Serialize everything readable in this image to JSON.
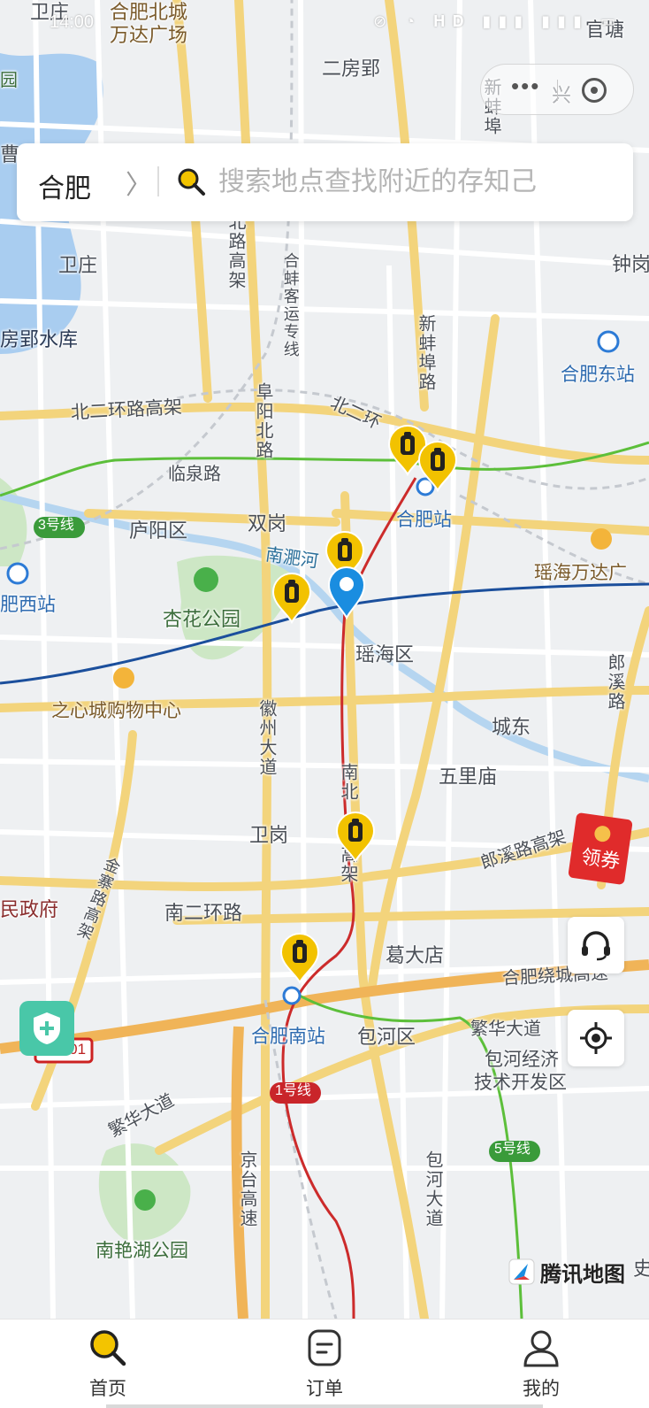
{
  "status_bar": {
    "time": "14:00",
    "system_icons": "⊘ ◔ 𝐇𝐃 ▮▮▮ ▮▮▮ ▭"
  },
  "capsule": {
    "more_icon": "more-dots-icon",
    "close_icon": "close-target-icon"
  },
  "search": {
    "city": "合肥",
    "chevron": "〉",
    "placeholder": "搜索地点查找附近的存知己",
    "value": ""
  },
  "map_labels": {
    "weizhuang_top": "卫庄",
    "wanda_beicheng_1": "合肥北城",
    "wanda_beicheng_2": "万达广场",
    "guantang": "官塘",
    "erfangying": "二房郢",
    "xing": "兴",
    "xinbanglu_top": "新蚌埠",
    "cao": "曹",
    "yuan": "园",
    "beilu_gaojia": "北路高架",
    "hebang_yunzhuan": "合蚌客运专线",
    "weizhuang": "卫庄",
    "zhongan": "钟岗",
    "dafangying": "房郢水库",
    "xinbengbulu": "新蚌埠路",
    "hefei_dongzhan": "合肥东站",
    "bei2huan_gaojia": "北二环路高架",
    "fuyang_beilu": "阜阳北路",
    "bei2huan": "北二环",
    "linquanlu": "临泉路",
    "line3": "3号线",
    "luyang": "庐阳区",
    "shuanggang": "双岗",
    "hefeizhan": "合肥站",
    "yaohai_wanda": "瑶海万达广",
    "nanfeihe": "南淝河",
    "feixi_zhan": "肥西站",
    "xinghua_park": "杏花公园",
    "yaohai": "瑶海区",
    "zhixincheng": "之心城购物中心",
    "langxilu": "郎溪路",
    "huizhou_dadao": "徽州大道",
    "chengdong": "城东",
    "nanbei_gaojia": "南北",
    "jia": "高架",
    "wulimiao": "五里庙",
    "weigang": "卫岗",
    "langxi_gaojia": "郎溪路高架",
    "jinzhai_gaojia": "金寨路高架",
    "minzhengfu": "民政府",
    "nan2huan": "南二环路",
    "gedadian": "葛大店",
    "ring_gaosu": "合肥绕城高速",
    "nanzhan": "合肥南站",
    "baohe": "包河区",
    "fanhua_e": "繁华大道",
    "baohe_jingji_1": "包河经济",
    "baohe_jingji_2": "技术开发区",
    "g4001": "G4001",
    "line1": "1号线",
    "fanhua_w": "繁华大道",
    "line5": "5号线",
    "jingtai": "京台高速",
    "baohe_dadao": "包河大道",
    "nanyanhu": "南艳湖公园",
    "shi": "史"
  },
  "map_attribution": "腾讯地图",
  "red_packet": "领券",
  "tabs": [
    {
      "label": "首页",
      "icon": "search-icon"
    },
    {
      "label": "订单",
      "icon": "order-icon"
    },
    {
      "label": "我的",
      "icon": "user-icon"
    }
  ],
  "colors": {
    "accent_yellow": "#f3c400",
    "marker_yellow": "#f2c200",
    "marker_blue": "#1a8de0",
    "metro_red": "#cc2b2b",
    "metro_green": "#5cbf3a",
    "metro_blue": "#1b4f9c",
    "road_yellow": "#f6d98a",
    "water": "#a9cdf0",
    "park": "#cde7c5"
  }
}
